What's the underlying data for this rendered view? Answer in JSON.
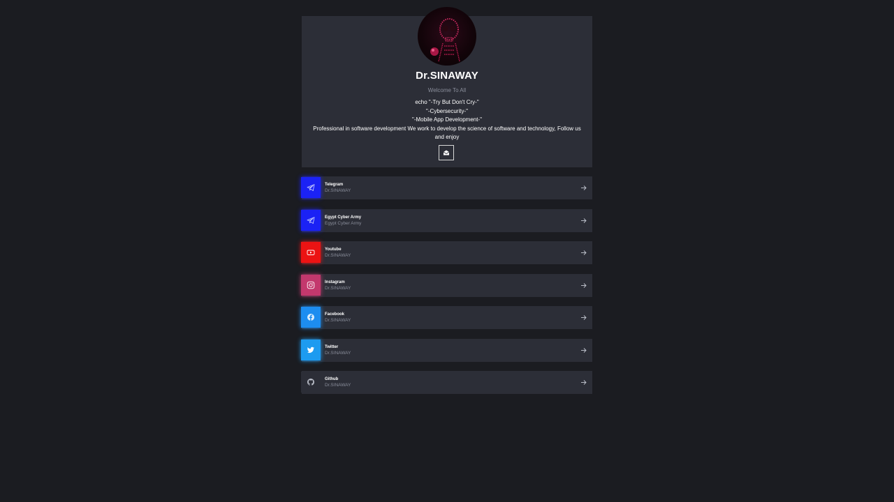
{
  "profile": {
    "name": "Dr.SINAWAY",
    "welcome": "Welcome To All",
    "bio_lines": [
      "echo \"-Try But Don't Cry-\"",
      "\"-Cybersecurity-\"",
      "\"-Mobile App Development-\"",
      "Professional in software development We work to develop the science of software and technology, Follow us and enjoy"
    ],
    "avatar_icon": "skull-avatar",
    "email_icon": "envelope-icon"
  },
  "links": [
    {
      "title": "Telegram",
      "subtitle": "Dr.SINAWAY",
      "icon": "telegram-icon",
      "color": "#1b22f5"
    },
    {
      "title": "Egypt Cyber Army",
      "subtitle": "Egypt Cyber Army",
      "icon": "telegram-icon",
      "color": "#1b22f5"
    },
    {
      "title": "Youtube",
      "subtitle": "Dr.SINAWAY",
      "icon": "youtube-icon",
      "color": "#ec1313"
    },
    {
      "title": "Instagram",
      "subtitle": "Dr.SINAWAY",
      "icon": "instagram-icon",
      "color": "#c3386d"
    },
    {
      "title": "Facebook",
      "subtitle": "Dr.SINAWAY",
      "icon": "facebook-icon",
      "color": "#1d8df0"
    },
    {
      "title": "Twitter",
      "subtitle": "Dr.SINAWAY",
      "icon": "twitter-icon",
      "color": "#1d9bf0"
    },
    {
      "title": "Github",
      "subtitle": "Dr.SINAWAY",
      "icon": "github-icon",
      "color": "#2c2e37"
    }
  ],
  "colors": {
    "background": "#1b1c21",
    "card": "#2c2e37",
    "muted_text": "#8a8e9b"
  }
}
